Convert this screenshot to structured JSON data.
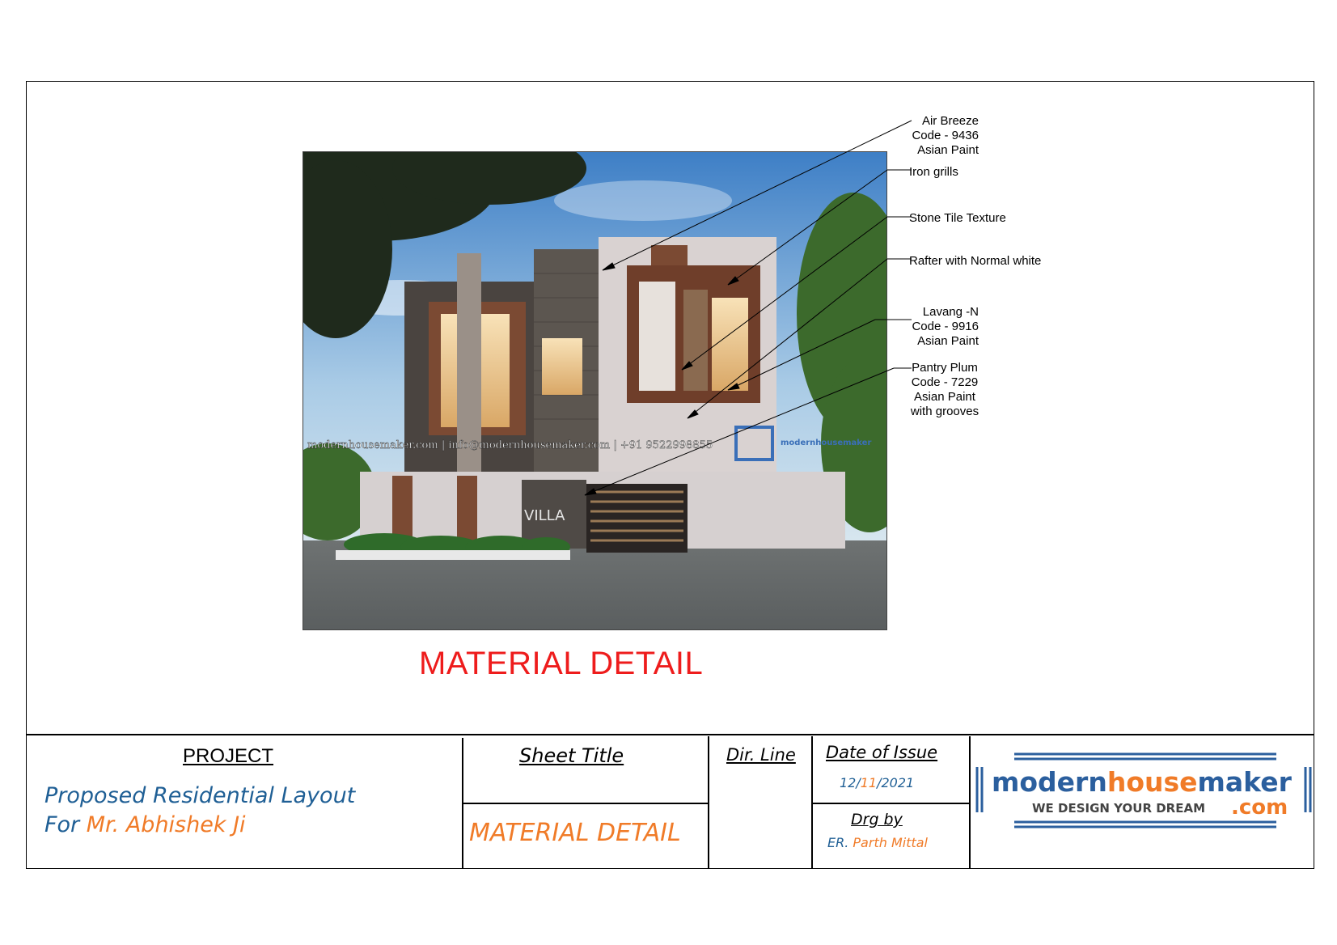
{
  "image": {
    "watermark": "modernhousemaker.com  |  info@modernhousemaker.com  |  +91 9522998855",
    "sign_text": "VILLA"
  },
  "callouts": [
    {
      "lines": [
        "Air Breeze",
        "Code - 9436",
        "Asian Paint"
      ]
    },
    {
      "lines": [
        "Iron grills"
      ]
    },
    {
      "lines": [
        "Stone Tile Texture"
      ]
    },
    {
      "lines": [
        "Rafter with Normal white"
      ]
    },
    {
      "lines": [
        "Lavang -N",
        "Code - 9916",
        "Asian Paint"
      ]
    },
    {
      "lines": [
        "Pantry Plum",
        "Code - 7229",
        "Asian Paint",
        "with grooves"
      ]
    }
  ],
  "main_title": "MATERIAL DETAIL",
  "title_block": {
    "project_label": "PROJECT",
    "project_line1": "Proposed Residential Layout",
    "project_line2_prefix": "For",
    "project_line2_name": "Mr. Abhishek Ji",
    "sheet_title_label": "Sheet Title",
    "sheet_title_value": "MATERIAL DETAIL",
    "dir_line_label": "Dir. Line",
    "date_label": "Date of Issue",
    "date_day": "12/",
    "date_month": "11",
    "date_year": "/2021",
    "drg_by_label": "Drg by",
    "drg_by_prefix": "ER.",
    "drg_by_name": "Parth Mittal"
  },
  "logo": {
    "brand_part1": "modern",
    "brand_part2": "house",
    "brand_part3": "maker",
    "tagline": "WE DESIGN YOUR DREAM",
    "suffix": ".com"
  },
  "colors": {
    "title_red": "#ee1c1c",
    "text_blue": "#1f5f95",
    "text_orange": "#f07b28",
    "logo_blue": "#2b5f9e"
  }
}
